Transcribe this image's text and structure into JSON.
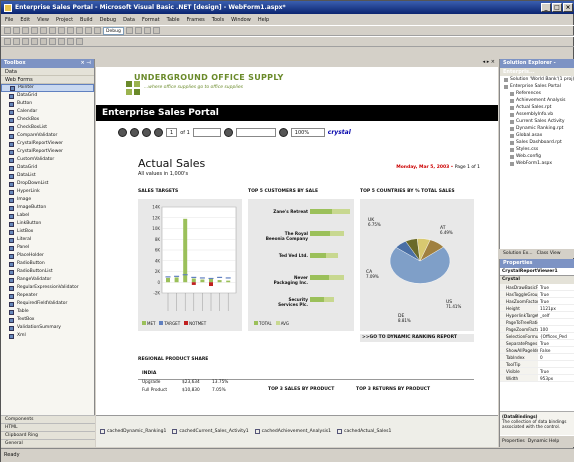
{
  "window": {
    "title": "Enterprise Sales Portal - Microsoft Visual Basic .NET [design] - WebForm1.aspx*"
  },
  "menu": [
    "File",
    "Edit",
    "View",
    "Project",
    "Build",
    "Debug",
    "Data",
    "Format",
    "Table",
    "Frames",
    "Tools",
    "Window",
    "Help"
  ],
  "toolbar": {
    "config": "Debug"
  },
  "toolbox": {
    "title": "Toolbox",
    "sections": [
      "Data",
      "Web Forms"
    ],
    "items": [
      "Pointer",
      "DataGrid",
      "Button",
      "Calendar",
      "CheckBox",
      "CheckBoxList",
      "CompareValidator",
      "CrystalReportViewer",
      "CrystalReportViewer",
      "CustomValidator",
      "DataGrid",
      "DataList",
      "DropDownList",
      "HyperLink",
      "Image",
      "ImageButton",
      "Label",
      "LinkButton",
      "ListBox",
      "Literal",
      "Panel",
      "PlaceHolder",
      "RadioButton",
      "RadioButtonList",
      "RangeValidator",
      "RegularExpressionValidator",
      "Repeater",
      "RequiredFieldValidator",
      "Table",
      "TextBox",
      "ValidationSummary",
      "Xml"
    ],
    "footer": [
      "Components",
      "HTML",
      "Clipboard Ring",
      "General"
    ]
  },
  "page": {
    "logo": "UNDERGROUND OFFICE SUPPLY",
    "tagline": "...where office supplies go to office supplies",
    "banner": "Enterprise Sales Portal",
    "viewer": {
      "page_box": "1",
      "of": "of 1",
      "zoom": "100%",
      "crystal": "crystal"
    }
  },
  "report": {
    "title": "Actual Sales",
    "subtitle": "All values in 1,000's",
    "date": "Monday, Mar 5, 2003",
    "page": "Page 1 of 1",
    "col1": "SALES TARGETS",
    "col2": "TOP 5 CUSTOMERS BY SALE",
    "col3": "TOP 5 COUNTRIES BY % TOTAL SALES",
    "link": ">>GO TO DYNAMIC RANKING REPORT",
    "regional": "REGIONAL PRODUCT SHARE",
    "region": "INDIA",
    "rows": [
      [
        "Upgrade",
        "$23,634",
        "13.75%"
      ],
      [
        "Full Product",
        "$10,830",
        "7.05%"
      ]
    ],
    "top3p": "TOP 3 SALES BY PRODUCT",
    "top3r": "TOP 3 RETURNS BY PRODUCT"
  },
  "chart_data": [
    {
      "type": "bar",
      "title": "SALES TARGETS",
      "ylim": [
        -2000,
        14000
      ],
      "series": [
        {
          "name": "MET"
        },
        {
          "name": "TARGET"
        },
        {
          "name": "NOTMET"
        }
      ],
      "legend": "bottom"
    },
    {
      "type": "bar",
      "title": "TOP 5 CUSTOMERS BY SALE",
      "categories": [
        "Zane's Retreat",
        "The Royal Beeonia Company",
        "Ted Ved Ltd.",
        "Never Packaging Inc.",
        "Security Services Plc."
      ],
      "series": [
        {
          "name": "TOTAL"
        },
        {
          "name": "AVG"
        }
      ],
      "legend": "bottom"
    },
    {
      "type": "pie",
      "title": "TOP 5 COUNTRIES BY % TOTAL SALES",
      "categories": [
        "UK",
        "AT",
        "CA",
        "DE",
        "US"
      ],
      "values": [
        6.75,
        6.49,
        7.09,
        8.81,
        71.41
      ],
      "value_labels": [
        "6.75%",
        "6.49%",
        "7.09%",
        "8.81%",
        "71.41%"
      ]
    }
  ],
  "tray": [
    "cachedDynamic_Ranking1",
    "cachedCurrent_Sales_Activity1",
    "cachedAchievement_Analysis1",
    "cachedActual_Sales1"
  ],
  "solution": {
    "title": "Solution Explorer - Enterpris...",
    "items": [
      "Solution 'World Bank'(1 proj)",
      "Enterprise Sales Portal",
      "References",
      "Achievement Analysis",
      "Actual Sales.rpt",
      "AssemblyInfo.vb",
      "Current Sales Activity",
      "Dynamic Ranking.rpt",
      "Global.asax",
      "Sales Dashboard.rpt",
      "Styles.css",
      "Web.config",
      "WebForm1.aspx"
    ]
  },
  "props": {
    "title": "Properties",
    "selected": "CrystalReportViewer1 Crystal",
    "rows": [
      [
        "HasDrawBasicFunc",
        "True"
      ],
      [
        "HasToggleGroup",
        "True"
      ],
      [
        "HasZoomFactor",
        "True"
      ],
      [
        "Height",
        "1121px"
      ],
      [
        "HyperlinkTarget",
        "_self"
      ],
      [
        "PageToTreeRatio",
        ""
      ],
      [
        "PageZoomFactor",
        "100"
      ],
      [
        "SelectionFormula",
        "{Offices_Ped"
      ],
      [
        "SeparatePages",
        "True"
      ],
      [
        "ShowAllPageIds",
        "False"
      ],
      [
        "TabIndex",
        "0"
      ],
      [
        "ToolTip",
        ""
      ],
      [
        "Visible",
        "True"
      ],
      [
        "Width",
        "953px"
      ]
    ],
    "desc_title": "(DataBindings)",
    "desc": "The collection of data bindings associated with the control.",
    "tabs": [
      "Properties",
      "Dynamic Help"
    ]
  },
  "solution_tabs": [
    "Solution Ex...",
    "Class View"
  ],
  "status": "Ready"
}
